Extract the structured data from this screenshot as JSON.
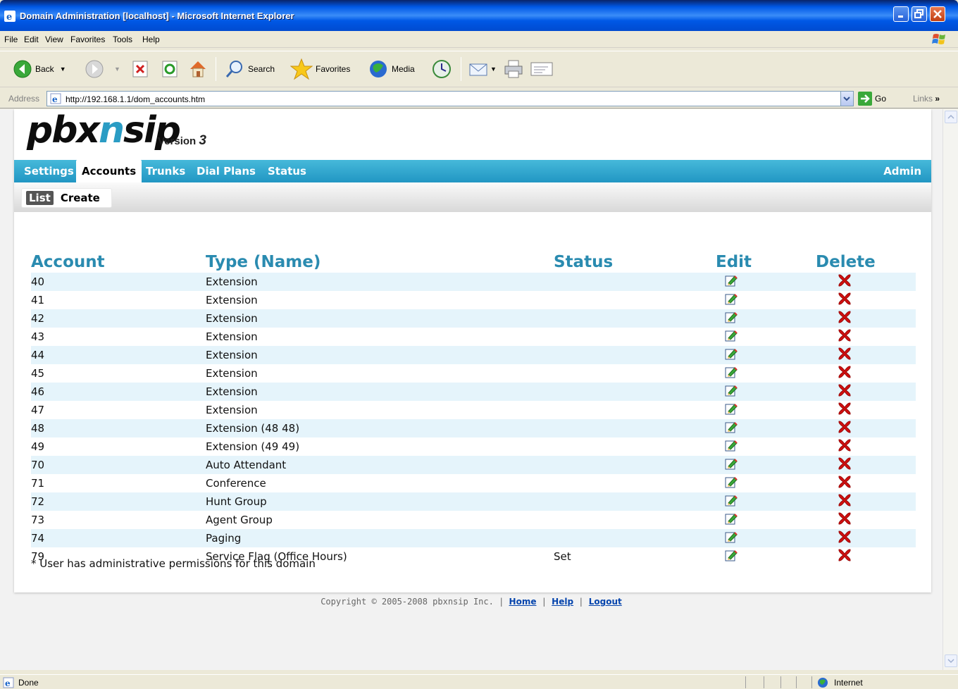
{
  "window": {
    "title": "Domain Administration [localhost] - Microsoft Internet Explorer"
  },
  "menu": [
    "File",
    "Edit",
    "View",
    "Favorites",
    "Tools",
    "Help"
  ],
  "toolbar": {
    "back": "Back",
    "search": "Search",
    "favorites": "Favorites",
    "media": "Media"
  },
  "address": {
    "label": "Address",
    "url": "http://192.168.1.1/dom_accounts.htm",
    "go": "Go",
    "links": "Links"
  },
  "brand": {
    "logo_a": "pbx",
    "logo_b": "n",
    "logo_c": "sip",
    "version_label": "Version",
    "version_num": "3"
  },
  "nav": {
    "items": [
      "Settings",
      "Accounts",
      "Trunks",
      "Dial Plans",
      "Status"
    ],
    "active": "Accounts",
    "admin": "Admin"
  },
  "subnav": {
    "items": [
      "List",
      "Create"
    ],
    "active": "List"
  },
  "table": {
    "headers": [
      "Account",
      "Type (Name)",
      "Status",
      "Edit",
      "Delete"
    ],
    "rows": [
      {
        "account": "40",
        "type": "Extension",
        "status": ""
      },
      {
        "account": "41",
        "type": "Extension",
        "status": ""
      },
      {
        "account": "42",
        "type": "Extension",
        "status": ""
      },
      {
        "account": "43",
        "type": "Extension",
        "status": ""
      },
      {
        "account": "44",
        "type": "Extension",
        "status": ""
      },
      {
        "account": "45",
        "type": "Extension",
        "status": ""
      },
      {
        "account": "46",
        "type": "Extension",
        "status": ""
      },
      {
        "account": "47",
        "type": "Extension",
        "status": ""
      },
      {
        "account": "48",
        "type": "Extension (48 48)",
        "status": ""
      },
      {
        "account": "49",
        "type": "Extension (49 49)",
        "status": ""
      },
      {
        "account": "70",
        "type": "Auto Attendant",
        "status": ""
      },
      {
        "account": "71",
        "type": "Conference",
        "status": ""
      },
      {
        "account": "72",
        "type": "Hunt Group",
        "status": ""
      },
      {
        "account": "73",
        "type": "Agent Group",
        "status": ""
      },
      {
        "account": "74",
        "type": "Paging",
        "status": ""
      },
      {
        "account": "79",
        "type": "Service Flag (Office Hours)",
        "status": "Set"
      }
    ]
  },
  "note": "* User has administrative permissions for this domain",
  "footer": {
    "copyright": "Copyright © 2005-2008 pbxnsip Inc. |",
    "home": "Home",
    "help": "Help",
    "logout": "Logout",
    "sep": "|"
  },
  "status": {
    "done": "Done",
    "zone": "Internet"
  },
  "colors": {
    "accent": "#2a9cc4",
    "nav_bg": "#2196c3",
    "row_alt": "#e5f4fb",
    "delete_red": "#d01010"
  }
}
